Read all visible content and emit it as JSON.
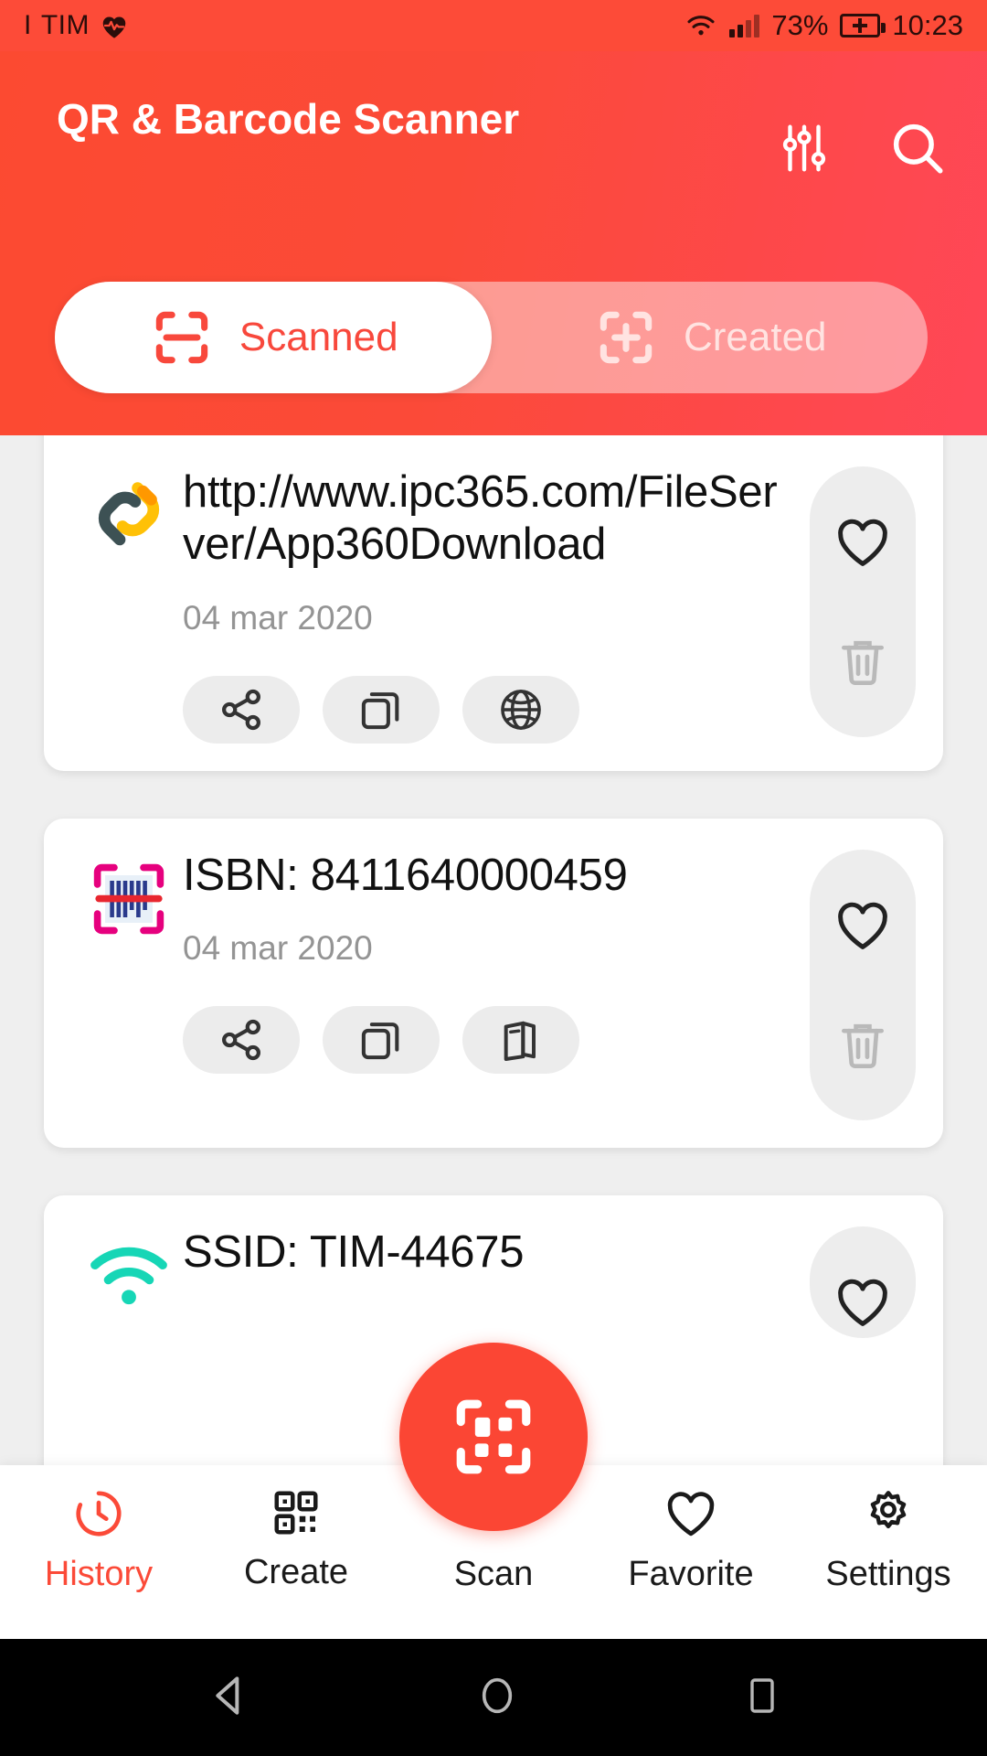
{
  "status_bar": {
    "carrier": "TIM",
    "signal_prefix": "I",
    "battery_percent": "73%",
    "time": "10:23",
    "icons": [
      "heart-rate-icon",
      "wifi-icon",
      "signal-icon",
      "battery-charging-icon"
    ]
  },
  "header": {
    "title": "QR & Barcode Scanner",
    "filter_icon": "sliders-icon",
    "search_icon": "search-icon"
  },
  "tabs": [
    {
      "label": "Scanned",
      "icon": "scan-frame-icon",
      "active": true
    },
    {
      "label": "Created",
      "icon": "scan-frame-plus-icon",
      "active": false
    }
  ],
  "colors": {
    "accent": "#fb4a38",
    "accent_light": "#ff4757",
    "page_bg": "#efefef",
    "card_bg": "#ffffff",
    "action_bg": "#ececec",
    "date_text": "#949494",
    "wifi_teal": "#16d6b6",
    "link_yellow": "#ffc107",
    "link_dark": "#3d5154",
    "barcode_pink": "#e6007e",
    "barcode_blue": "#2a3a8c"
  },
  "items": [
    {
      "type": "url",
      "icon": "link-chain-icon",
      "text": "http://www.ipc365.com/FileServer/App360Download",
      "date": "04 mar 2020",
      "actions": [
        "share-icon",
        "copy-icon",
        "globe-icon"
      ],
      "side_actions": [
        "heart-icon",
        "trash-icon"
      ]
    },
    {
      "type": "isbn",
      "icon": "barcode-scan-icon",
      "text": "ISBN: 8411640000459",
      "date": "04 mar 2020",
      "actions": [
        "share-icon",
        "copy-icon",
        "book-icon"
      ],
      "side_actions": [
        "heart-icon",
        "trash-icon"
      ]
    },
    {
      "type": "wifi",
      "icon": "wifi-icon",
      "text": "SSID: TIM-44675",
      "date": "",
      "actions": [],
      "side_actions": [
        "heart-icon"
      ]
    }
  ],
  "bottom_nav": [
    {
      "label": "History",
      "icon": "history-clock-icon",
      "active": true
    },
    {
      "label": "Create",
      "icon": "qr-grid-icon",
      "active": false
    },
    {
      "label": "Scan",
      "icon": "qr-scan-icon",
      "active": false
    },
    {
      "label": "Favorite",
      "icon": "heart-icon",
      "active": false
    },
    {
      "label": "Settings",
      "icon": "gear-icon",
      "active": false
    }
  ],
  "android_nav": {
    "back": "back-triangle-icon",
    "home": "home-circle-icon",
    "recents": "recents-square-icon"
  }
}
